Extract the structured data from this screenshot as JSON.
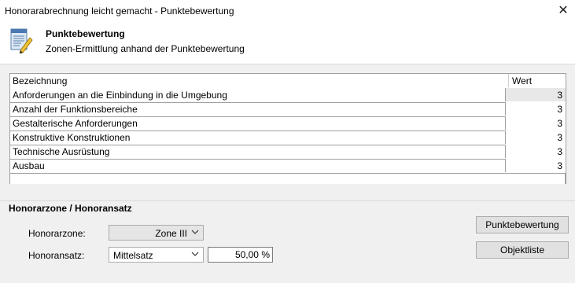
{
  "window": {
    "title": "Honorarabrechnung leicht gemacht - Punktebewertung"
  },
  "header": {
    "title": "Punktebewertung",
    "subtitle": "Zonen-Ermittlung anhand der Punktebewertung"
  },
  "table": {
    "columns": [
      "Bezeichnung",
      "Wert"
    ],
    "rows": [
      {
        "name": "Anforderungen an die Einbindung in die Umgebung",
        "value": "3"
      },
      {
        "name": "Anzahl der Funktionsbereiche",
        "value": "3"
      },
      {
        "name": "Gestalterische Anforderungen",
        "value": "3"
      },
      {
        "name": "Konstruktive Konstruktionen",
        "value": "3"
      },
      {
        "name": "Technische Ausrüstung",
        "value": "3"
      },
      {
        "name": "Ausbau",
        "value": "3"
      }
    ]
  },
  "honorar": {
    "section_title": "Honorarzone / Honoransatz",
    "zone_label": "Honorarzone:",
    "zone_value": "Zone III",
    "ansatz_label": "Honoransatz:",
    "ansatz_value": "Mittelsatz",
    "percent_value": "50,00 %"
  },
  "buttons": {
    "punktebewertung": "Punktebewertung",
    "objektliste": "Objektliste"
  }
}
